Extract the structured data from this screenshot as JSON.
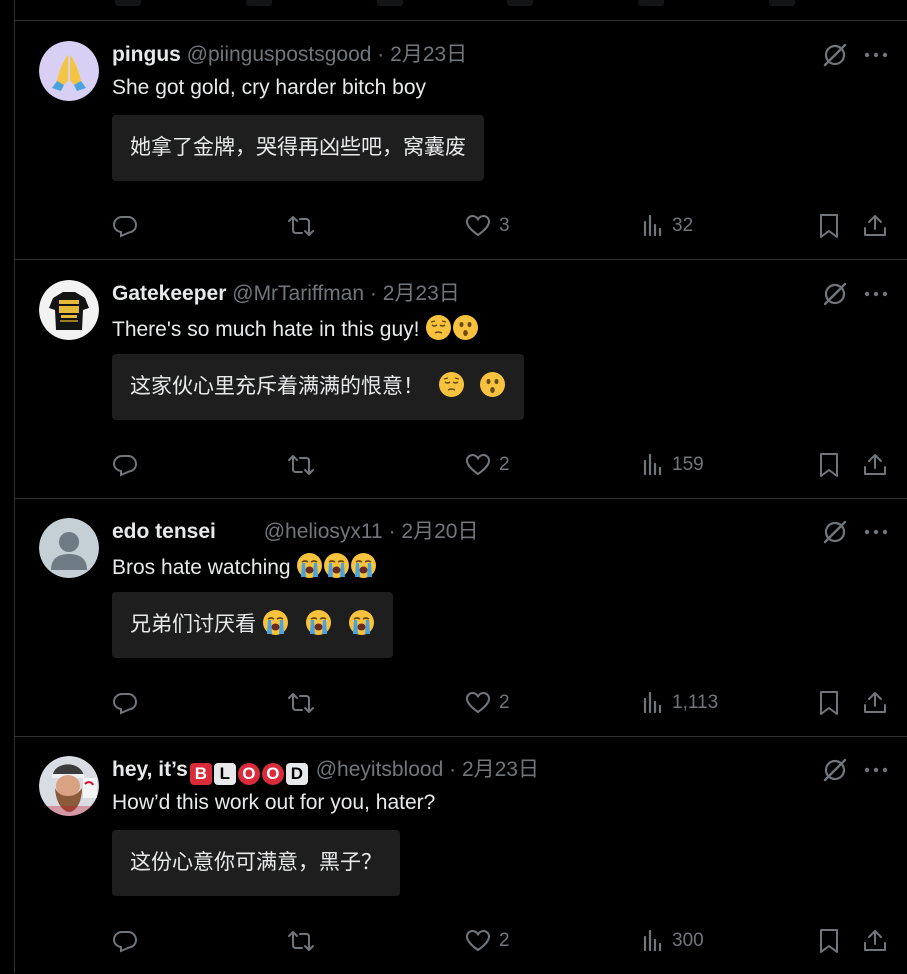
{
  "posts": [
    {
      "name": "pingus",
      "handle": "@piinguspostsgood",
      "separator": "·",
      "date": "2月23日",
      "text": "She got gold, cry harder bitch boy",
      "emojis": [],
      "translation": "她拿了金牌，哭得再凶些吧，窝囊废",
      "translation_emojis": [],
      "likes": "3",
      "views": "32",
      "avatar_icon": "praying-hands-emoji"
    },
    {
      "name": "Gatekeeper",
      "handle": "@MrTariffman",
      "separator": "·",
      "date": "2月23日",
      "text": "There's so much hate in this guy!",
      "emojis": [
        "relieved-face",
        "hushed-face"
      ],
      "translation": "这家伙心里充斥着满满的恨意！",
      "translation_emojis": [
        "relieved-face",
        "hushed-face"
      ],
      "likes": "2",
      "views": "159",
      "avatar_icon": "tshirt-photo"
    },
    {
      "name": "edo tensei",
      "handle": "@heliosyx11",
      "separator": "·",
      "date": "2月20日",
      "text": "Bros hate watching",
      "emojis": [
        "loudly-crying-face",
        "loudly-crying-face",
        "loudly-crying-face"
      ],
      "translation": "兄弟们讨厌看",
      "translation_emojis": [
        "loudly-crying-face",
        "loudly-crying-face",
        "loudly-crying-face"
      ],
      "likes": "2",
      "views": "1,113",
      "avatar_icon": "default-profile"
    },
    {
      "name": "hey, it’s",
      "name_badges": [
        "B",
        "L",
        "O",
        "O",
        "D"
      ],
      "handle": "@heyitsblood",
      "separator": "·",
      "date": "2月23日",
      "text": "How’d this work out for you, hater?",
      "emojis": [],
      "translation": "这份心意你可满意，黑子？",
      "translation_emojis": [],
      "likes": "2",
      "views": "300",
      "avatar_icon": "bearded-man-photo"
    }
  ],
  "colors": {
    "background": "#000000",
    "text": "#e7e9ea",
    "muted": "#71767b",
    "divider": "#2f3336",
    "translation_bg": "#1f1e1e"
  },
  "icons": [
    "reply-icon",
    "repost-icon",
    "like-icon",
    "views-icon",
    "bookmark-icon",
    "share-icon",
    "grok-icon",
    "more-icon"
  ]
}
